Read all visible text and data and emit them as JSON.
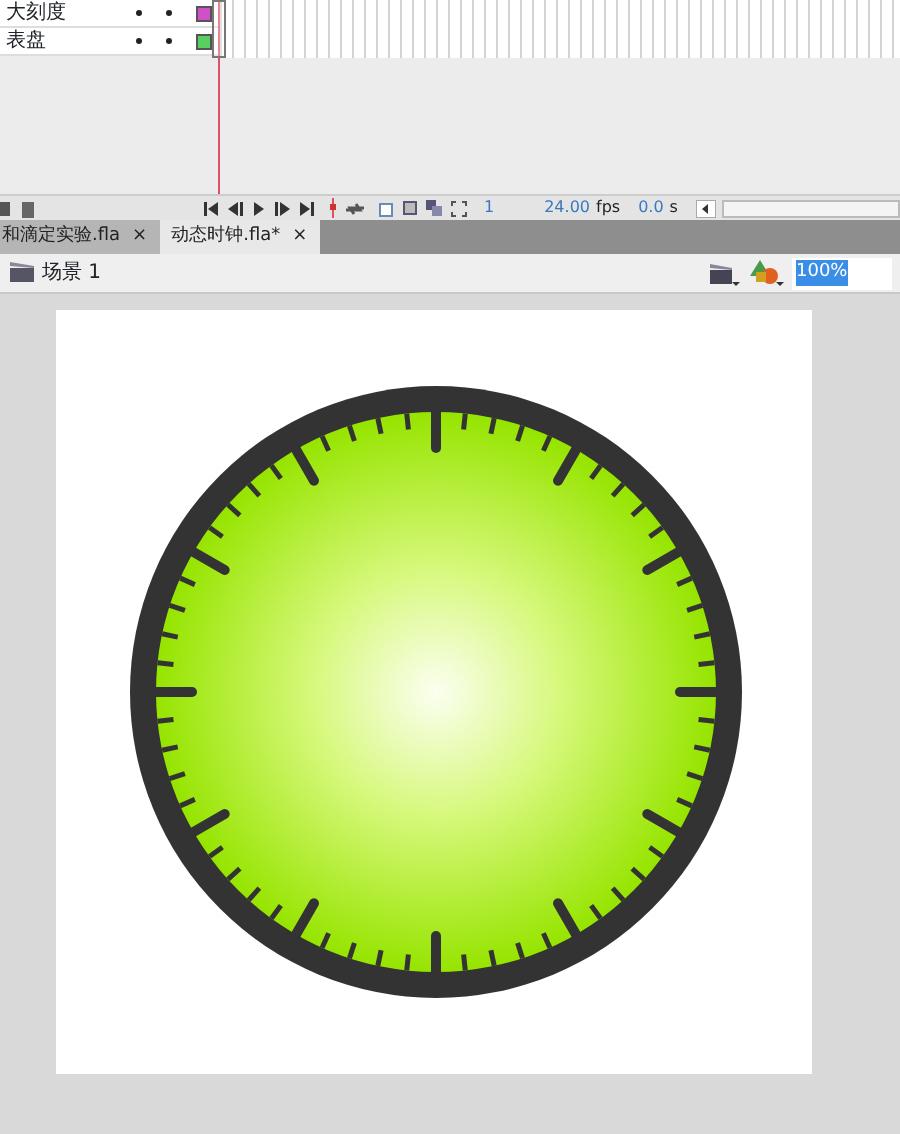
{
  "layers": [
    {
      "name": "大刻度",
      "color": "#d050c8"
    },
    {
      "name": "表盘",
      "color": "#58d060"
    }
  ],
  "timeline_status": {
    "frame": "1",
    "fps": "24.00",
    "fps_unit": "fps",
    "time": "0.0",
    "time_unit": "s"
  },
  "document_tabs": [
    {
      "label": "和滴定实验.fla",
      "close": "×",
      "selected": false
    },
    {
      "label": "动态时钟.fla*",
      "close": "×",
      "selected": true
    }
  ],
  "scene": {
    "label": "场景 1"
  },
  "zoom": {
    "value": "100%"
  }
}
